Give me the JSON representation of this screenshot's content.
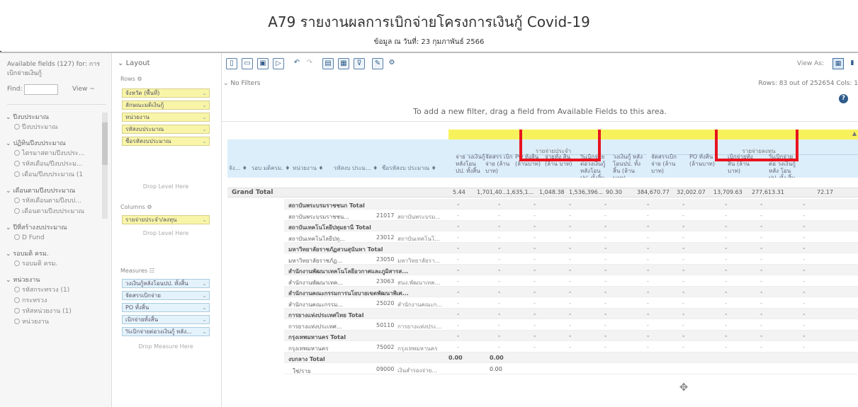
{
  "report": {
    "title": "A79 รายงานผลการเบิกจ่ายโครงการเงินกู้ Covid-19",
    "subtitle": "ข้อมูล ณ วันที่: 23 กุมภาพันธ์ 2566"
  },
  "fields_panel": {
    "header": "Available fields (127) for: การเบิกจ่ายเงินกู้",
    "find_label": "Find:",
    "find_value": "",
    "view_label": "View ~",
    "groups": [
      {
        "label": "ปีงบประมาณ",
        "items": [
          "ปีงบประมาณ"
        ]
      },
      {
        "label": "ปฏิทินปีงบประมาณ",
        "items": [
          "ไตรมาสตามปีงบประ...",
          "รหัสเดือน/ปีงบประม...",
          "เดือน/ปีงบประมาณ (1"
        ]
      },
      {
        "label": "เดือนตามปีงบประมาณ",
        "items": [
          "รหัสเดือนตามปีงบป...",
          "เดือนตามปีงบประมาณ"
        ]
      },
      {
        "label": "ปีที่สร้างงบประมาณ",
        "items": [
          "D Fund"
        ]
      },
      {
        "label": "รอบมติ ครม.",
        "items": [
          "รอบมติ ครม."
        ]
      },
      {
        "label": "หน่วยงาน",
        "items": [
          "รหัสกระทรวง (1)",
          "กระทรวง",
          "รหัสหน่วยงาน (1)",
          "หน่วยงาน"
        ]
      }
    ]
  },
  "layout_panel": {
    "title": "Layout",
    "rows_label": "Rows",
    "rows": [
      "จังหวัด (พื้นที่)",
      "ลักษณะมติเงินกู้",
      "หน่วยงาน",
      "รหัสงบประมาณ",
      "ชื่อรหัสงบประมาณ"
    ],
    "rows_drop": "Drop Level Here",
    "columns_label": "Columns",
    "columns": [
      "รายจ่ายประจำ/ลงทุน"
    ],
    "columns_drop": "Drop Level Here",
    "measures_label": "Measures",
    "measures": [
      "วงเงินกู้หลังโอนปป. ทั้งสิ้น",
      "จัดสรรเบิกจ่าย",
      "PO ทั้งสิ้น",
      "เบิกจ่ายทั้งสิ้น",
      "%เบิกจ่ายต่อวงเงินกู้ หลัง..."
    ],
    "measures_drop": "Drop Measure Here"
  },
  "toolbar": {
    "view_as": "View As:",
    "filters": "No Filters",
    "rows_info": "Rows: 83 out of 252654  Cols: 1",
    "filter_msg": "To add a new filter, drag a field from Available Fields to this area."
  },
  "grid": {
    "group1": "รายจ่ายประจำ",
    "group2": "รายจ่ายลงทุน",
    "left_headers": [
      "จัง... ♦",
      "รอบ มติครม. ♦",
      "หน่วยงาน ♦",
      "รหัสงบ ประม... ♦",
      "ชื่อรหัสงบ ประมาณ ♦"
    ],
    "value_headers": [
      "จ่าย วงเงินกู้ หลังโอน ปป. ทั้งสิ้น",
      "จัดสรร เบิก จ่าย (ล้าน บาท)",
      "PO ทั้งสิ้น (ล้านบาท)",
      "จ่ายทั้ง สิ้น (ล้าน บาท)",
      "%เบิกจ่าย ต่อวงเงินกู้ หลังโอน ปป. ทั้งสิ้น",
      "วงเงินกู้ หลัง โอนปป. ทั้ง สิ้น (ล้าน บาท)",
      "จัดสรรเบิกจ่าย (ล้านบาท)",
      "PO ทั้งสิ้น (ล้านบาท)",
      "เบิกจ่ายทั้งสิ้น (ล้านบาท)",
      "%เบิกจ่ายต่อ วงเงินกู้ หลัง โอนปป. ทั้ง สิ้น"
    ],
    "grand_total_label": "Grand Total",
    "grand_total_values": [
      "5.44",
      "1,701,40...",
      "1,635,1...",
      "1,048.38",
      "1,536,396...",
      "90.30",
      "384,670.77",
      "32,002.07",
      "13,709.63",
      "277,613.31",
      "72.17"
    ],
    "yes_label": "ใช่/ราย",
    "rows": [
      {
        "type": "total",
        "name": "สถาบันพระบรมราชชนก Total"
      },
      {
        "type": "detail",
        "name": "สถาบันพระบรมราชชน...",
        "code": "21017",
        "budget": "สถาบันพระบรม..."
      },
      {
        "type": "total",
        "name": "สถาบันเทคโนโลยีปทุมธานี Total"
      },
      {
        "type": "detail",
        "name": "สถาบันเทคโนโลยีปทุ...",
        "code": "23012",
        "budget": "สถาบันเทคโนโ..."
      },
      {
        "type": "total",
        "name": "มหาวิทยาลัยราชภัฏสวนสุนันทา Total"
      },
      {
        "type": "detail",
        "name": "มหาวิทยาลัยราชภัฏ...",
        "code": "23050",
        "budget": "มหาวิทยาลัยรา..."
      },
      {
        "type": "total",
        "name": "สำนักงานพัฒนาเทคโนโลยีอวกาศและภูมิสารส..."
      },
      {
        "type": "detail",
        "name": "สำนักงานพัฒนาเทค...",
        "code": "23063",
        "budget": "สนง.พัฒนาเทค..."
      },
      {
        "type": "total",
        "name": "สำนักงานคณะกรรมการนโยบายเขตพัฒนาพิเศ..."
      },
      {
        "type": "detail",
        "name": "สำนักงานคณะกรรม...",
        "code": "25020",
        "budget": "สำนักงานคณะก..."
      },
      {
        "type": "total",
        "name": "การยางแห่งประเทศไทย Total"
      },
      {
        "type": "detail",
        "name": "การยางแห่งประเทศ...",
        "code": "50110",
        "budget": "การยางแห่งประ..."
      },
      {
        "type": "total",
        "name": "กรุงเทพมหานคร Total"
      },
      {
        "type": "detail",
        "name": "กรุงเทพมหานคร",
        "code": "75002",
        "budget": "กรุงเทพมหานคร"
      },
      {
        "type": "total",
        "name": "งบกลาง Total",
        "v1": "0.00",
        "v2": "0.00"
      },
      {
        "type": "detail",
        "name": "",
        "code": "09000",
        "budget": "เงินสำรองจ่าย...",
        "v2": "0.00"
      }
    ],
    "dash": "-"
  },
  "colors": {
    "accent": "#2d5b8b",
    "yellow": "#f7f25c",
    "blue_header": "#dceefa",
    "highlight": "#e8131f"
  }
}
